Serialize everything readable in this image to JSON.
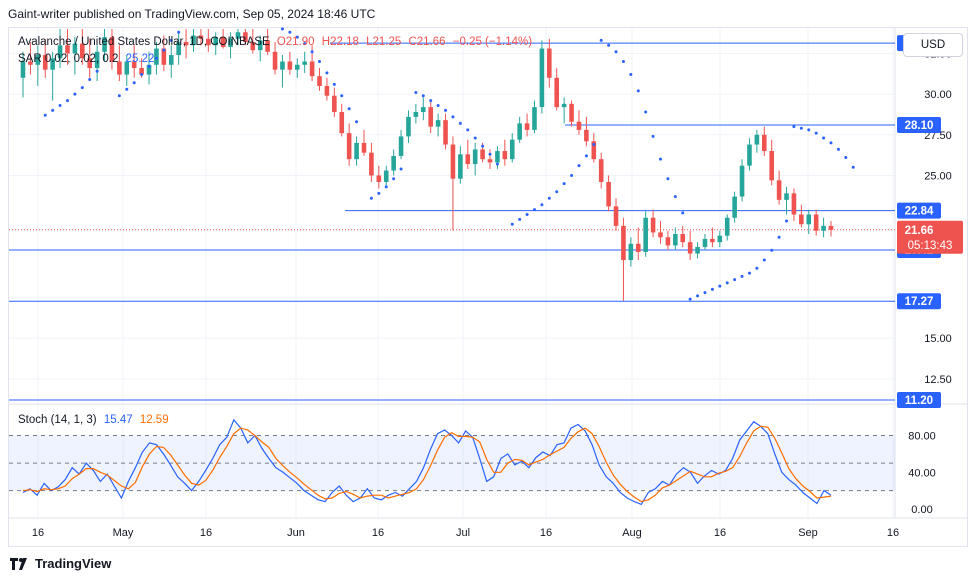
{
  "header": {
    "publisher": "Gaint-writer published on TradingView.com, Sep 05, 2024 18:46 UTC"
  },
  "legend": {
    "symbol": "Avalanche / United States Dollar, 1D, COINBASE",
    "open": "O21.90",
    "high": "H22.18",
    "low": "L21.25",
    "close": "C21.66",
    "change": "−0.25 (−1.14%)"
  },
  "sar_legend": {
    "label": "SAR 0.02, 0.02, 0.2",
    "value": "25.22"
  },
  "stoch_legend": {
    "label": "Stoch (14, 1, 3)",
    "k": "15.47",
    "d": "12.59"
  },
  "currency_button": "USD",
  "footer": {
    "brand": "TradingView"
  },
  "colors": {
    "up": "#26a69a",
    "down": "#ef5350",
    "sar": "#2962ff",
    "level": "#2962ff",
    "stoch_k": "#2962ff",
    "stoch_d": "#ff6d00"
  },
  "chart_data": [
    {
      "type": "candlestick",
      "y_axis_ticks": [
        "32.50",
        "30.00",
        "27.50",
        "25.00",
        "15.00",
        "12.50"
      ],
      "x_axis_ticks": [
        "16",
        "May",
        "16",
        "Jun",
        "16",
        "Jul",
        "16",
        "Aug",
        "16",
        "Sep",
        "16"
      ],
      "horizontal_levels": [
        "33.13",
        "28.10",
        "22.84",
        "20.42",
        "17.27",
        "11.20"
      ],
      "last_price": {
        "value": "21.66",
        "countdown": "05:13:43"
      },
      "ylim": [
        11.2,
        34.0
      ],
      "candles": [
        [
          31,
          32.6,
          29.8,
          32.0
        ],
        [
          32,
          33.2,
          31.2,
          31.8
        ],
        [
          31.8,
          33.0,
          30.5,
          32.4
        ],
        [
          32.4,
          33.4,
          31.0,
          31.5
        ],
        [
          31.5,
          32.6,
          29.6,
          32.2
        ],
        [
          32.2,
          34.0,
          31.6,
          33.0
        ],
        [
          33,
          34.0,
          31.8,
          32.5
        ],
        [
          32.5,
          33.5,
          31.2,
          33.1
        ],
        [
          33.1,
          34.0,
          31.8,
          32.2
        ],
        [
          32.2,
          33.4,
          31.0,
          31.6
        ],
        [
          31.6,
          33.0,
          30.8,
          32.6
        ],
        [
          32.6,
          34.0,
          32.0,
          33.5
        ],
        [
          33.5,
          34.0,
          31.5,
          32.0
        ],
        [
          32,
          33.0,
          30.8,
          31.2
        ],
        [
          31.2,
          32.4,
          30.5,
          32.0
        ],
        [
          32,
          33.0,
          31.0,
          31.6
        ],
        [
          31.6,
          32.2,
          31.0,
          31.2
        ],
        [
          31.2,
          32.6,
          30.6,
          31.8
        ],
        [
          31.8,
          33.2,
          31.2,
          32.8
        ],
        [
          32.8,
          33.6,
          31.4,
          31.8
        ],
        [
          31.8,
          33.0,
          31.0,
          32.4
        ],
        [
          32.4,
          33.8,
          31.8,
          33.2
        ],
        [
          33.2,
          34.0,
          32.2,
          33.0
        ],
        [
          33,
          34.0,
          32.6,
          33.6
        ],
        [
          33.6,
          34.0,
          33.0,
          33.4
        ],
        [
          33.4,
          34.0,
          32.6,
          33.0
        ],
        [
          33,
          33.8,
          32.4,
          33.5
        ],
        [
          33.5,
          34.0,
          32.8,
          32.9
        ],
        [
          32.9,
          33.8,
          32.2,
          33.4
        ],
        [
          33.4,
          34.0,
          33.0,
          33.8
        ],
        [
          33.8,
          34.0,
          33.0,
          33.2
        ],
        [
          33.2,
          34.0,
          32.5,
          32.7
        ],
        [
          32.7,
          33.6,
          32.0,
          33.3
        ],
        [
          33.3,
          34.0,
          32.4,
          32.6
        ],
        [
          32.6,
          33.2,
          31.2,
          31.5
        ],
        [
          31.5,
          32.4,
          30.4,
          32.0
        ],
        [
          32,
          32.6,
          31.2,
          31.5
        ],
        [
          31.5,
          32.2,
          31.0,
          31.8
        ],
        [
          31.8,
          32.6,
          31.3,
          32.0
        ],
        [
          32,
          33.0,
          30.8,
          31.1
        ],
        [
          31.1,
          31.6,
          30.2,
          30.5
        ],
        [
          30.5,
          31.0,
          29.6,
          29.9
        ],
        [
          29.9,
          30.4,
          28.6,
          28.9
        ],
        [
          28.9,
          29.4,
          27.4,
          27.6
        ],
        [
          27.6,
          28.2,
          25.6,
          26.0
        ],
        [
          26,
          27.4,
          25.6,
          27.0
        ],
        [
          27,
          27.8,
          26.2,
          26.4
        ],
        [
          26.4,
          27.0,
          24.6,
          25.0
        ],
        [
          25,
          25.6,
          24.2,
          24.6
        ],
        [
          24.6,
          25.6,
          24.3,
          25.3
        ],
        [
          25.3,
          26.6,
          25.0,
          26.2
        ],
        [
          26.2,
          27.8,
          26.0,
          27.4
        ],
        [
          27.4,
          29.0,
          27.0,
          28.6
        ],
        [
          28.6,
          29.4,
          28.2,
          28.9
        ],
        [
          28.9,
          29.8,
          28.4,
          29.2
        ],
        [
          29.2,
          29.6,
          27.6,
          28.0
        ],
        [
          28,
          28.8,
          27.4,
          28.4
        ],
        [
          28.4,
          28.8,
          26.6,
          26.9
        ],
        [
          26.9,
          27.4,
          21.6,
          24.8
        ],
        [
          24.8,
          26.8,
          24.5,
          26.3
        ],
        [
          26.3,
          27.2,
          25.4,
          25.7
        ],
        [
          25.7,
          27.0,
          25.0,
          26.6
        ],
        [
          26.6,
          27.0,
          25.8,
          26.0
        ],
        [
          26,
          26.6,
          25.4,
          25.8
        ],
        [
          25.8,
          26.8,
          25.4,
          26.5
        ],
        [
          26.5,
          27.2,
          25.6,
          26.0
        ],
        [
          26,
          27.6,
          25.8,
          27.2
        ],
        [
          27.2,
          28.6,
          27.0,
          28.2
        ],
        [
          28.2,
          28.8,
          27.4,
          27.8
        ],
        [
          27.8,
          29.6,
          27.6,
          29.2
        ],
        [
          29.2,
          33.3,
          28.8,
          32.8
        ],
        [
          32.8,
          33.4,
          30.4,
          31.0
        ],
        [
          31,
          31.6,
          29.0,
          29.2
        ],
        [
          29.2,
          29.8,
          28.2,
          29.4
        ],
        [
          29.4,
          29.6,
          28.0,
          28.3
        ],
        [
          28.3,
          29.0,
          27.5,
          27.8
        ],
        [
          27.8,
          28.6,
          26.8,
          27.1
        ],
        [
          27.1,
          27.6,
          25.8,
          26.0
        ],
        [
          26,
          26.4,
          24.2,
          24.6
        ],
        [
          24.6,
          25.0,
          22.8,
          23.1
        ],
        [
          23.1,
          23.6,
          21.6,
          21.9
        ],
        [
          21.9,
          22.4,
          17.3,
          19.8
        ],
        [
          19.8,
          21.2,
          19.4,
          20.8
        ],
        [
          20.8,
          21.8,
          19.8,
          20.3
        ],
        [
          20.3,
          22.8,
          20.0,
          22.4
        ],
        [
          22.4,
          22.9,
          21.2,
          21.5
        ],
        [
          21.5,
          22.2,
          20.8,
          21.2
        ],
        [
          21.2,
          21.6,
          20.4,
          20.7
        ],
        [
          20.7,
          21.8,
          20.4,
          21.4
        ],
        [
          21.4,
          21.9,
          20.6,
          20.9
        ],
        [
          20.9,
          21.6,
          19.8,
          20.2
        ],
        [
          20.2,
          20.9,
          19.9,
          20.6
        ],
        [
          20.6,
          21.4,
          20.4,
          21.1
        ],
        [
          21.1,
          21.8,
          20.6,
          20.9
        ],
        [
          20.9,
          21.6,
          20.6,
          21.3
        ],
        [
          21.3,
          22.6,
          21.0,
          22.4
        ],
        [
          22.4,
          24.0,
          22.1,
          23.7
        ],
        [
          23.7,
          26.0,
          23.4,
          25.6
        ],
        [
          25.6,
          27.3,
          25.3,
          26.9
        ],
        [
          26.9,
          27.8,
          26.4,
          27.5
        ],
        [
          27.5,
          28.0,
          26.2,
          26.5
        ],
        [
          26.5,
          27.2,
          24.4,
          24.7
        ],
        [
          24.7,
          25.3,
          23.2,
          23.5
        ],
        [
          23.5,
          24.3,
          22.6,
          23.9
        ],
        [
          23.9,
          24.2,
          22.2,
          22.6
        ],
        [
          22.6,
          23.2,
          21.8,
          22.0
        ],
        [
          22,
          22.9,
          21.4,
          22.6
        ],
        [
          22.6,
          22.9,
          21.3,
          21.6
        ],
        [
          21.6,
          22.4,
          21.2,
          21.9
        ],
        [
          21.9,
          22.2,
          21.25,
          21.66
        ]
      ],
      "sar": [
        [
          3,
          28.7
        ],
        [
          4,
          29.0
        ],
        [
          5,
          29.3
        ],
        [
          6,
          29.6
        ],
        [
          7,
          30.0
        ],
        [
          8,
          30.4
        ],
        [
          9,
          30.9
        ],
        [
          10,
          31.4
        ],
        [
          13,
          29.9
        ],
        [
          14,
          30.3
        ],
        [
          15,
          30.7
        ],
        [
          16,
          31.2
        ],
        [
          17,
          31.7
        ],
        [
          18,
          32.2
        ],
        [
          19,
          32.7
        ],
        [
          20,
          33.3
        ],
        [
          21,
          33.8
        ],
        [
          35,
          34.0
        ],
        [
          36,
          33.8
        ],
        [
          37,
          33.5
        ],
        [
          38,
          33.1
        ],
        [
          39,
          32.6
        ],
        [
          40,
          32.0
        ],
        [
          41,
          31.3
        ],
        [
          42,
          30.6
        ],
        [
          43,
          29.9
        ],
        [
          44,
          29.1
        ],
        [
          45,
          28.3
        ],
        [
          47,
          23.6
        ],
        [
          48,
          23.9
        ],
        [
          49,
          24.3
        ],
        [
          50,
          24.8
        ],
        [
          51,
          25.4
        ],
        [
          53,
          30.1
        ],
        [
          54,
          29.9
        ],
        [
          55,
          29.6
        ],
        [
          56,
          29.3
        ],
        [
          57,
          29.0
        ],
        [
          58,
          28.6
        ],
        [
          59,
          28.2
        ],
        [
          60,
          27.8
        ],
        [
          61,
          27.3
        ],
        [
          62,
          26.8
        ],
        [
          63,
          26.3
        ],
        [
          64,
          25.7
        ],
        [
          66,
          22.0
        ],
        [
          67,
          22.3
        ],
        [
          68,
          22.6
        ],
        [
          69,
          22.9
        ],
        [
          70,
          23.2
        ],
        [
          71,
          23.6
        ],
        [
          72,
          24.0
        ],
        [
          73,
          24.5
        ],
        [
          74,
          25.0
        ],
        [
          75,
          25.6
        ],
        [
          76,
          26.2
        ],
        [
          77,
          26.9
        ],
        [
          78,
          33.3
        ],
        [
          79,
          33.0
        ],
        [
          80,
          32.6
        ],
        [
          81,
          32.0
        ],
        [
          82,
          31.2
        ],
        [
          83,
          30.2
        ],
        [
          84,
          28.9
        ],
        [
          85,
          27.4
        ],
        [
          86,
          26.0
        ],
        [
          87,
          24.8
        ],
        [
          88,
          23.7
        ],
        [
          89,
          22.7
        ],
        [
          90,
          17.4
        ],
        [
          91,
          17.6
        ],
        [
          92,
          17.8
        ],
        [
          93,
          18.0
        ],
        [
          94,
          18.2
        ],
        [
          95,
          18.4
        ],
        [
          96,
          18.6
        ],
        [
          97,
          18.8
        ],
        [
          98,
          19.0
        ],
        [
          99,
          19.3
        ],
        [
          100,
          19.8
        ],
        [
          101,
          20.4
        ],
        [
          102,
          21.2
        ],
        [
          103,
          22.2
        ],
        [
          104,
          28.0
        ],
        [
          105,
          27.9
        ],
        [
          106,
          27.8
        ],
        [
          107,
          27.6
        ],
        [
          108,
          27.3
        ],
        [
          109,
          27.0
        ],
        [
          110,
          26.6
        ],
        [
          111,
          26.1
        ],
        [
          112,
          25.5
        ]
      ]
    },
    {
      "type": "line",
      "title": "Stoch (14, 1, 3)",
      "y_axis_ticks": [
        "80.00",
        "40.00",
        "0.00"
      ],
      "bands": [
        80,
        50,
        20
      ],
      "ylim": [
        -5,
        100
      ],
      "series": [
        {
          "name": "%K",
          "values": [
            18,
            22,
            15,
            28,
            20,
            24,
            32,
            45,
            38,
            50,
            42,
            30,
            38,
            25,
            12,
            30,
            45,
            62,
            72,
            70,
            60,
            48,
            35,
            28,
            20,
            30,
            42,
            55,
            70,
            78,
            97,
            88,
            72,
            80,
            66,
            55,
            45,
            40,
            34,
            28,
            20,
            15,
            10,
            8,
            18,
            25,
            15,
            8,
            12,
            22,
            12,
            10,
            15,
            18,
            14,
            22,
            30,
            45,
            65,
            82,
            86,
            80,
            72,
            85,
            78,
            55,
            30,
            35,
            55,
            60,
            48,
            52,
            45,
            56,
            62,
            58,
            70,
            72,
            88,
            92,
            85,
            70,
            48,
            35,
            28,
            18,
            12,
            8,
            5,
            18,
            22,
            30,
            26,
            38,
            45,
            40,
            28,
            36,
            42,
            38,
            42,
            55,
            75,
            85,
            95,
            90,
            82,
            60,
            40,
            32,
            26,
            18,
            12,
            6,
            20,
            15
          ]
        },
        {
          "name": "%D",
          "values": [
            20,
            21,
            19,
            22,
            21,
            22,
            25,
            33,
            38,
            44,
            44,
            40,
            37,
            31,
            25,
            22,
            29,
            46,
            60,
            68,
            67,
            59,
            48,
            37,
            28,
            26,
            31,
            42,
            56,
            68,
            82,
            88,
            86,
            80,
            73,
            67,
            55,
            47,
            40,
            34,
            27,
            21,
            15,
            11,
            12,
            17,
            19,
            16,
            12,
            14,
            15,
            15,
            12,
            14,
            16,
            18,
            22,
            32,
            47,
            64,
            78,
            83,
            79,
            79,
            78,
            73,
            54,
            40,
            40,
            50,
            54,
            53,
            48,
            51,
            54,
            59,
            63,
            67,
            77,
            84,
            88,
            82,
            68,
            51,
            37,
            27,
            19,
            13,
            8,
            10,
            15,
            23,
            26,
            31,
            36,
            41,
            38,
            35,
            35,
            39,
            41,
            45,
            57,
            72,
            85,
            90,
            89,
            77,
            61,
            44,
            33,
            25,
            19,
            12,
            13,
            14
          ]
        }
      ]
    }
  ]
}
